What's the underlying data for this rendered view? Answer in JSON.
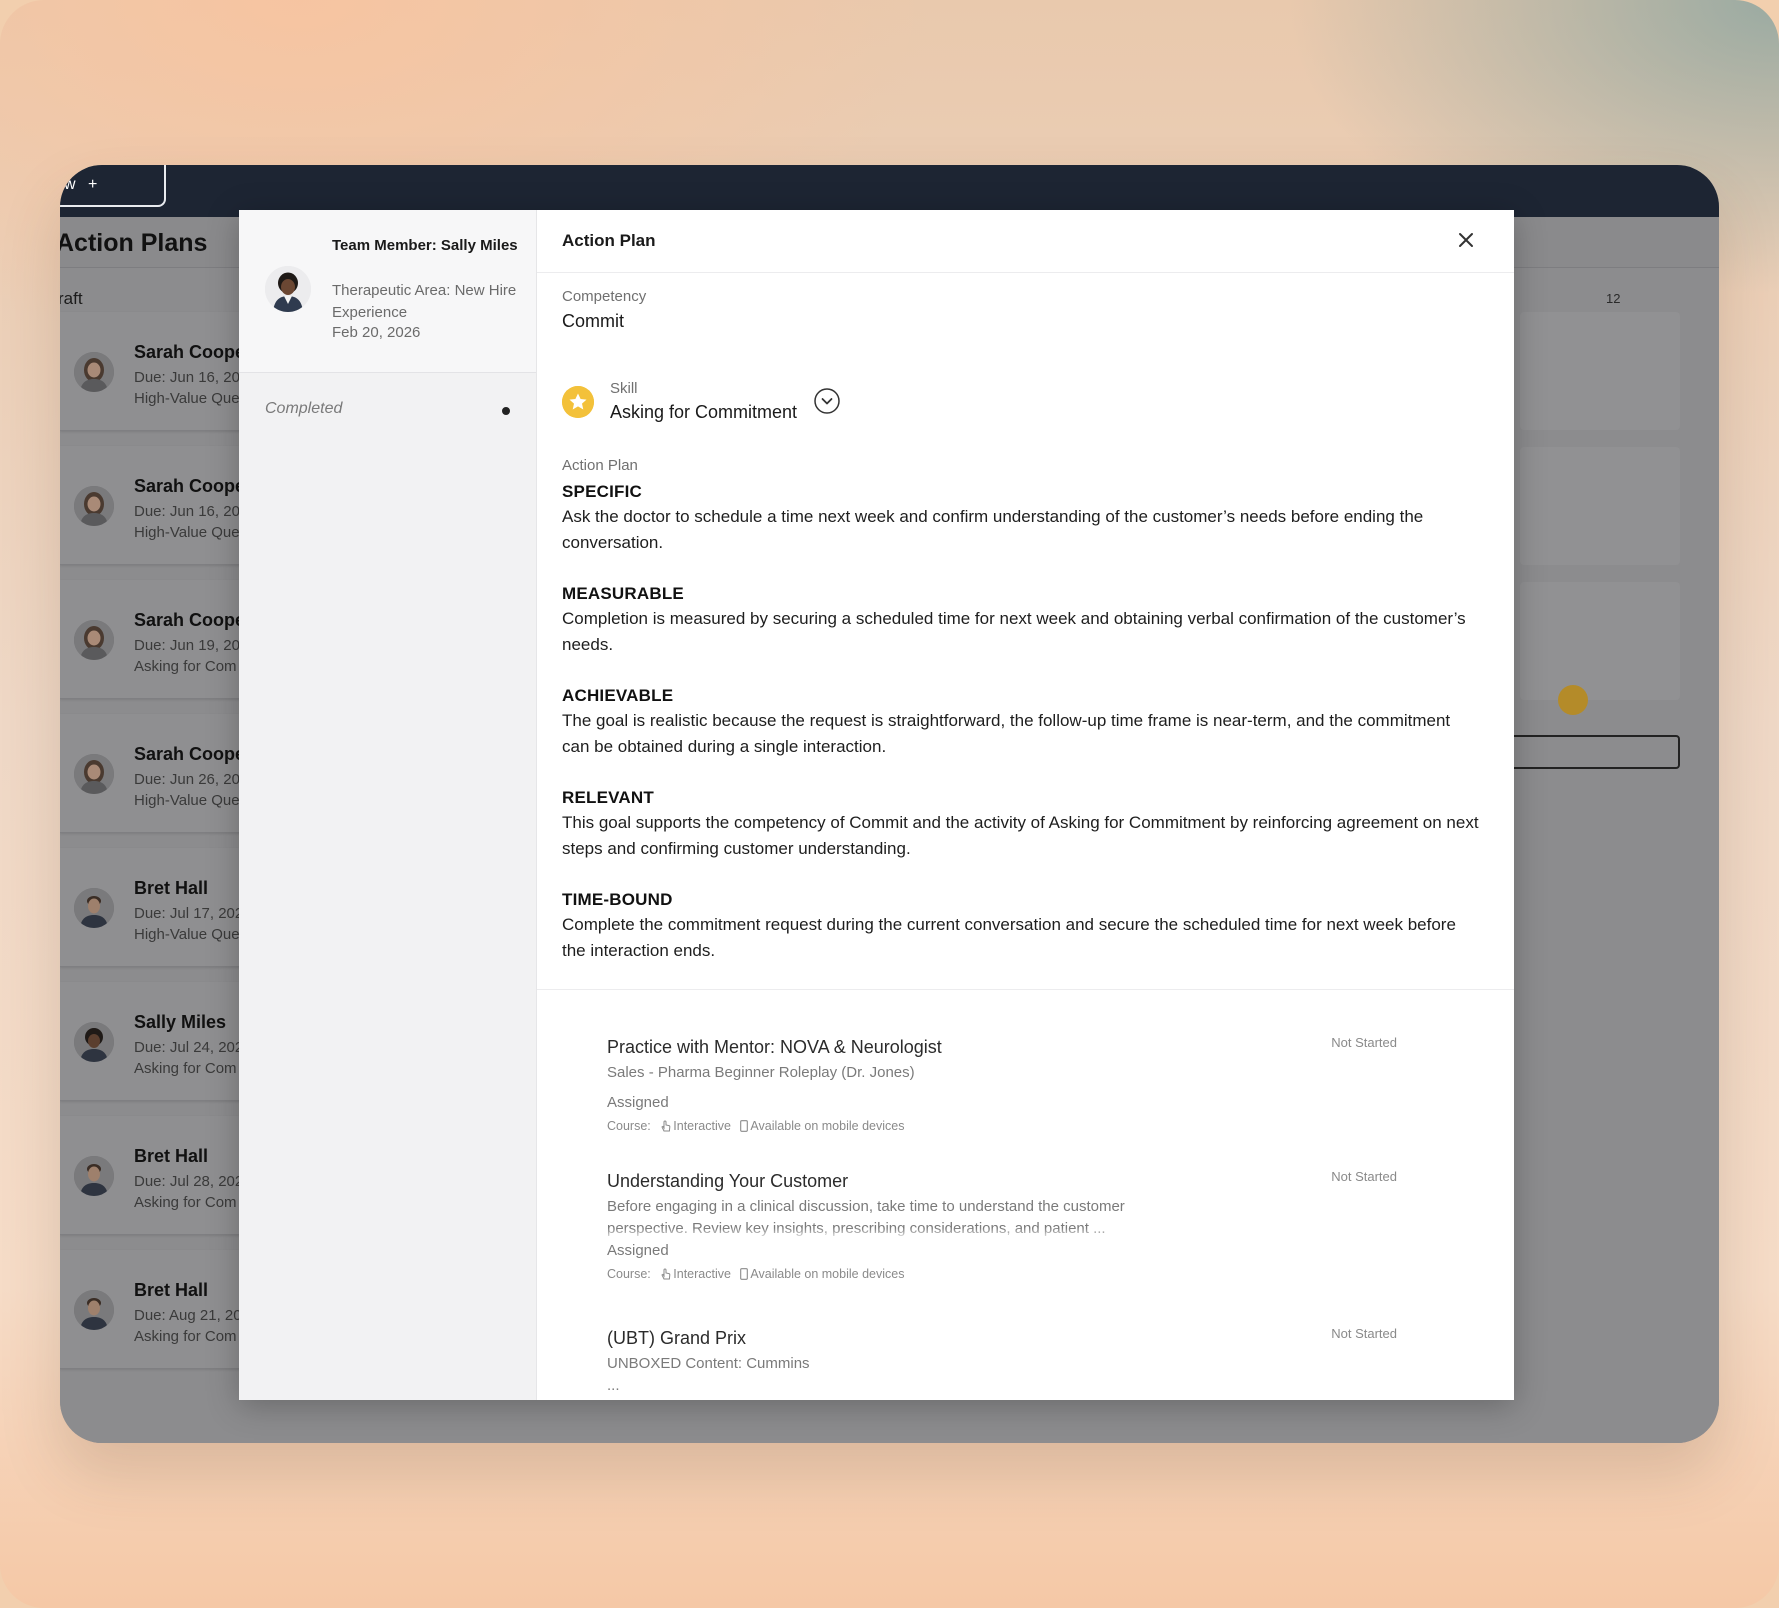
{
  "app": {
    "tab_partial": "w",
    "new_tab_plus": "+",
    "page_title": "Action Plans",
    "draft_label": "raft",
    "right_count": "12"
  },
  "background_cards": [
    {
      "name": "Sarah Coope",
      "due": "Due: Jun 16, 20",
      "skill": "High-Value Que"
    },
    {
      "name": "Sarah Coope",
      "due": "Due: Jun 16, 20",
      "skill": "High-Value Que"
    },
    {
      "name": "Sarah Coope",
      "due": "Due: Jun 19, 20",
      "skill": "Asking for Com"
    },
    {
      "name": "Sarah Coope",
      "due": "Due: Jun 26, 20",
      "skill": "High-Value Que"
    },
    {
      "name": "Bret Hall",
      "due": "Due: Jul 17, 202",
      "skill": "High-Value Que"
    },
    {
      "name": "Sally Miles",
      "due": "Due: Jul 24, 202",
      "skill": "Asking for Com"
    },
    {
      "name": "Bret Hall",
      "due": "Due: Jul 28, 202",
      "skill": "Asking for Com"
    },
    {
      "name": "Bret Hall",
      "due": "Due: Aug 21, 20",
      "skill": "Asking for Com"
    }
  ],
  "modal": {
    "sidebar": {
      "team_member": "Team Member: Sally Miles",
      "therapeutic_area": "Therapeutic Area: New Hire Experience",
      "date": "Feb 20, 2026",
      "status": "Completed"
    },
    "title": "Action Plan",
    "competency_label": "Competency",
    "competency_value": "Commit",
    "skill_label": "Skill",
    "skill_value": "Asking for Commitment",
    "action_plan_label": "Action Plan",
    "smart": [
      {
        "heading": "SPECIFIC",
        "text": "Ask the doctor to schedule a time next week and confirm understanding of the customer’s needs before ending the conversation."
      },
      {
        "heading": "MEASURABLE",
        "text": "Completion is measured by securing a scheduled time for next week and obtaining verbal confirmation of the customer’s needs."
      },
      {
        "heading": "ACHIEVABLE",
        "text": "The goal is realistic because the request is straightforward, the follow-up time frame is near-term, and the commitment can be obtained during a single interaction."
      },
      {
        "heading": "RELEVANT",
        "text": "This goal supports the competency of Commit and the activity of Asking for Commitment by reinforcing agreement on next steps and confirming customer understanding."
      },
      {
        "heading": "TIME-BOUND",
        "text": "Complete the commitment request during the current conversation and secure the scheduled time for next week before the interaction ends."
      }
    ],
    "courses": [
      {
        "title": "Practice with Mentor: NOVA & Neurologist",
        "subtitle": "Sales - Pharma Beginner Roleplay (Dr. Jones)",
        "assignment": "Assigned",
        "meta_label": "Course:",
        "meta_interactive": "Interactive",
        "meta_mobile": "Available on mobile devices",
        "status": "Not Started"
      },
      {
        "title": "Understanding Your Customer",
        "subtitle": "Before engaging in a clinical discussion, take time to understand the customer perspective. Review key insights, prescribing considerations, and patient ... challenges to help anticipate questions and tailor the conversation.",
        "assignment": "Assigned",
        "meta_label": "Course:",
        "meta_interactive": "Interactive",
        "meta_mobile": "Available on mobile devices",
        "status": "Not Started"
      },
      {
        "title": "(UBT) Grand Prix",
        "subtitle": "UNBOXED Content: Cummins",
        "more": "...",
        "status": "Not Started"
      }
    ]
  },
  "colors": {
    "topbar": "#1d2533",
    "star": "#f3c13a",
    "overlay": "#8c8c8e"
  }
}
